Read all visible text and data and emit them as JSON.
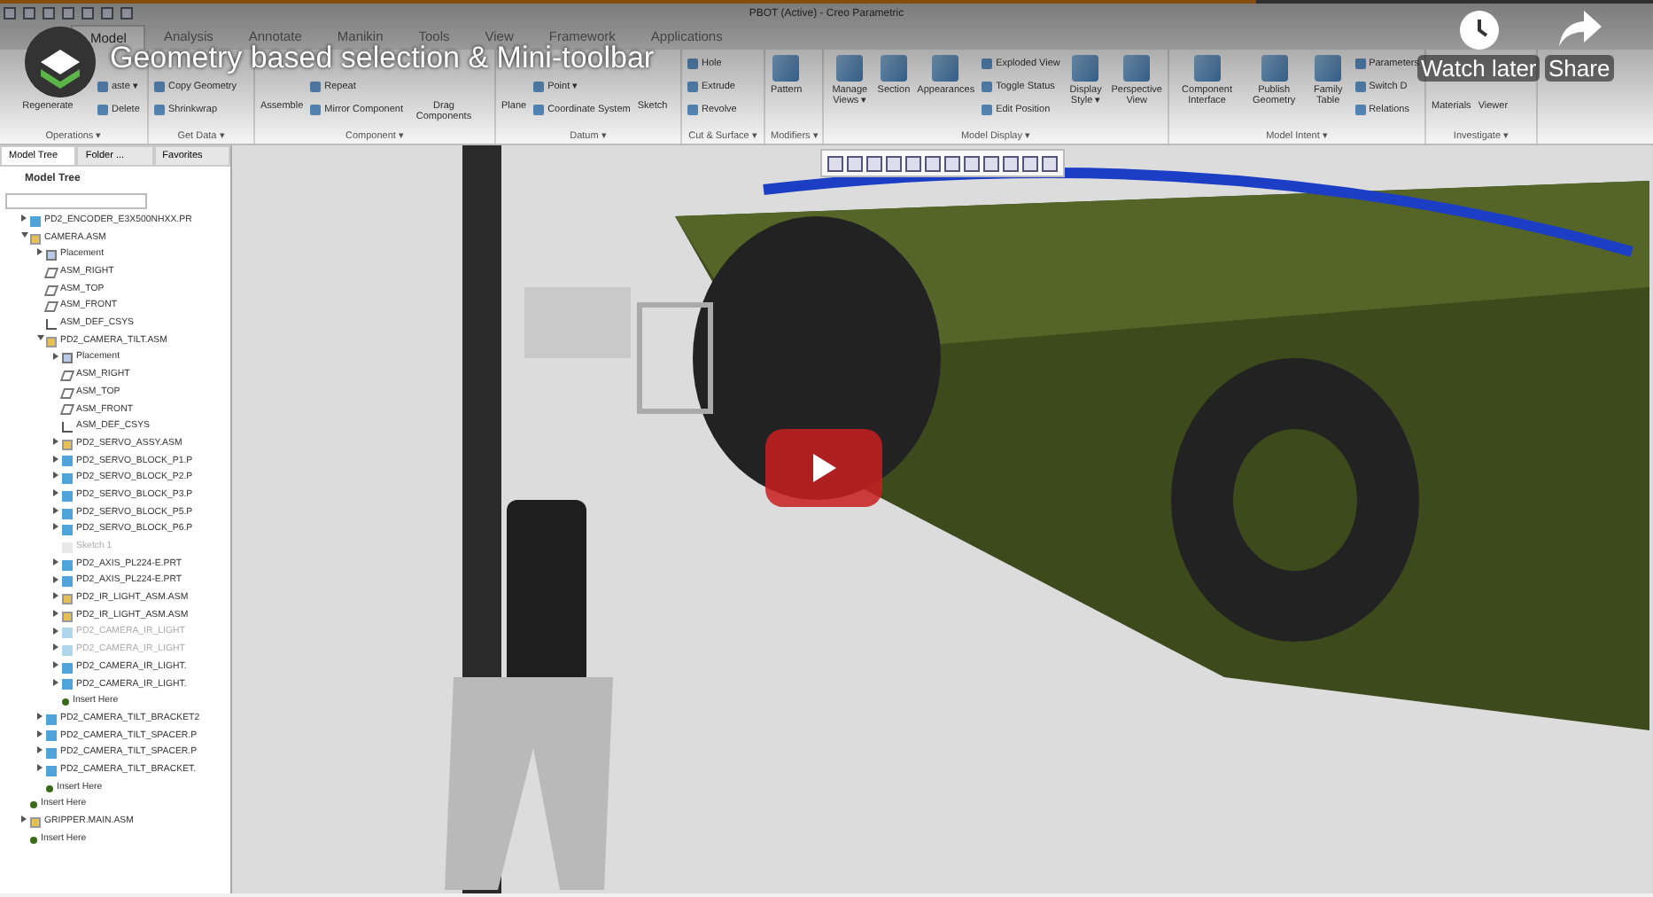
{
  "progress": {
    "level": 0.76
  },
  "window": {
    "title": "PBOT (Active) - Creo Parametric"
  },
  "ribbon_tabs": [
    {
      "label": "Model",
      "selected": true
    },
    {
      "label": "Analysis",
      "selected": false
    },
    {
      "label": "Annotate",
      "selected": false
    },
    {
      "label": "Manikin",
      "selected": false
    },
    {
      "label": "Tools",
      "selected": false
    },
    {
      "label": "View",
      "selected": false
    },
    {
      "label": "Framework",
      "selected": false
    },
    {
      "label": "Applications",
      "selected": false
    }
  ],
  "ribbon_groups": [
    {
      "label": "Operations ▾",
      "items": [
        {
          "kind": "large",
          "label": "Regenerate"
        },
        {
          "kind": "stack",
          "labels": [
            "aste ▾",
            "Delete"
          ]
        }
      ]
    },
    {
      "label": "Get Data ▾",
      "items": [
        {
          "kind": "stack",
          "labels": [
            "Copy Geometry",
            "Shrinkwrap"
          ]
        }
      ]
    },
    {
      "label": "Component ▾",
      "items": [
        {
          "kind": "large",
          "label": "Assemble"
        },
        {
          "kind": "stack",
          "labels": [
            "Repeat",
            "Mirror Component"
          ]
        },
        {
          "kind": "large",
          "label": "Drag Components"
        }
      ]
    },
    {
      "label": "Datum ▾",
      "items": [
        {
          "kind": "large",
          "label": "Plane"
        },
        {
          "kind": "stack",
          "labels": [
            "Point ▾",
            "Coordinate System"
          ]
        },
        {
          "kind": "large",
          "label": "Sketch"
        }
      ]
    },
    {
      "label": "Cut & Surface ▾",
      "items": [
        {
          "kind": "stack",
          "labels": [
            "Hole",
            "Extrude",
            "Revolve"
          ]
        }
      ]
    },
    {
      "label": "Modifiers ▾",
      "items": [
        {
          "kind": "large",
          "label": "Pattern"
        }
      ]
    },
    {
      "label": "Model Display ▾",
      "items": [
        {
          "kind": "large",
          "label": "Manage Views ▾"
        },
        {
          "kind": "large",
          "label": "Section"
        },
        {
          "kind": "large",
          "label": "Appearances"
        },
        {
          "kind": "stack",
          "labels": [
            "Exploded View",
            "Toggle Status",
            "Edit Position"
          ]
        },
        {
          "kind": "large",
          "label": "Display Style ▾"
        },
        {
          "kind": "large",
          "label": "Perspective View"
        }
      ]
    },
    {
      "label": "Model Intent ▾",
      "items": [
        {
          "kind": "large",
          "label": "Component Interface"
        },
        {
          "kind": "large",
          "label": "Publish Geometry"
        },
        {
          "kind": "large",
          "label": "Family Table"
        },
        {
          "kind": "stack",
          "labels": [
            "Parameters",
            "Switch D",
            "Relations"
          ]
        }
      ]
    },
    {
      "label": "Investigate ▾",
      "items": [
        {
          "kind": "large",
          "label": "Materials"
        },
        {
          "kind": "large",
          "label": "Viewer"
        }
      ]
    }
  ],
  "model_tree": {
    "tabs": [
      {
        "label": "Model Tree",
        "selected": true
      },
      {
        "label": "Folder ...",
        "selected": false
      },
      {
        "label": "Favorites",
        "selected": false
      }
    ],
    "title": "Model Tree",
    "items": [
      {
        "kind": "part",
        "label": "PD2_ENCODER_E3X500NHXX.PR",
        "expanded": false,
        "dimmed": false
      },
      {
        "kind": "asm",
        "label": "CAMERA.ASM",
        "expanded": true,
        "dimmed": false,
        "children": [
          {
            "kind": "placement",
            "label": "Placement",
            "expanded": false,
            "dimmed": false
          },
          {
            "kind": "datum",
            "label": "ASM_RIGHT",
            "dimmed": false
          },
          {
            "kind": "datum",
            "label": "ASM_TOP",
            "dimmed": false
          },
          {
            "kind": "datum",
            "label": "ASM_FRONT",
            "dimmed": false
          },
          {
            "kind": "csys",
            "label": "ASM_DEF_CSYS",
            "dimmed": false
          },
          {
            "kind": "asm",
            "label": "PD2_CAMERA_TILT.ASM",
            "expanded": true,
            "dimmed": false,
            "children": [
              {
                "kind": "placement",
                "label": "Placement",
                "expanded": false,
                "dimmed": false
              },
              {
                "kind": "datum",
                "label": "ASM_RIGHT",
                "dimmed": false
              },
              {
                "kind": "datum",
                "label": "ASM_TOP",
                "dimmed": false
              },
              {
                "kind": "datum",
                "label": "ASM_FRONT",
                "dimmed": false
              },
              {
                "kind": "csys",
                "label": "ASM_DEF_CSYS",
                "dimmed": false
              },
              {
                "kind": "asm",
                "label": "PD2_SERVO_ASSY.ASM",
                "expanded": false,
                "dimmed": false
              },
              {
                "kind": "part",
                "label": "PD2_SERVO_BLOCK_P1.P",
                "expanded": false,
                "dimmed": false
              },
              {
                "kind": "part",
                "label": "PD2_SERVO_BLOCK_P2.P",
                "expanded": false,
                "dimmed": false
              },
              {
                "kind": "part",
                "label": "PD2_SERVO_BLOCK_P3.P",
                "expanded": false,
                "dimmed": false
              },
              {
                "kind": "part",
                "label": "PD2_SERVO_BLOCK_P5.P",
                "expanded": false,
                "dimmed": false
              },
              {
                "kind": "part",
                "label": "PD2_SERVO_BLOCK_P6.P",
                "expanded": false,
                "dimmed": false
              },
              {
                "kind": "sketch",
                "label": "Sketch 1",
                "dimmed": true
              },
              {
                "kind": "part",
                "label": "PD2_AXIS_PL224-E.PRT",
                "expanded": false,
                "dimmed": false
              },
              {
                "kind": "part",
                "label": "PD2_AXIS_PL224-E.PRT",
                "expanded": false,
                "dimmed": false
              },
              {
                "kind": "asm",
                "label": "PD2_IR_LIGHT_ASM.ASM",
                "expanded": false,
                "dimmed": false
              },
              {
                "kind": "asm",
                "label": "PD2_IR_LIGHT_ASM.ASM",
                "expanded": false,
                "dimmed": false
              },
              {
                "kind": "part",
                "label": "PD2_CAMERA_IR_LIGHT",
                "expanded": false,
                "dimmed": true
              },
              {
                "kind": "part",
                "label": "PD2_CAMERA_IR_LIGHT",
                "expanded": false,
                "dimmed": true
              },
              {
                "kind": "part",
                "label": "PD2_CAMERA_IR_LIGHT.",
                "expanded": false,
                "dimmed": false
              },
              {
                "kind": "part",
                "label": "PD2_CAMERA_IR_LIGHT.",
                "expanded": false,
                "dimmed": false
              },
              {
                "kind": "insert",
                "label": "Insert Here",
                "dimmed": false
              }
            ]
          },
          {
            "kind": "part",
            "label": "PD2_CAMERA_TILT_BRACKET2",
            "expanded": false,
            "dimmed": false
          },
          {
            "kind": "part",
            "label": "PD2_CAMERA_TILT_SPACER.P",
            "expanded": false,
            "dimmed": false
          },
          {
            "kind": "part",
            "label": "PD2_CAMERA_TILT_SPACER.P",
            "expanded": false,
            "dimmed": false
          },
          {
            "kind": "part",
            "label": "PD2_CAMERA_TILT_BRACKET.",
            "expanded": false,
            "dimmed": false
          },
          {
            "kind": "insert",
            "label": "Insert Here",
            "dimmed": false
          }
        ]
      },
      {
        "kind": "insert",
        "label": "Insert Here",
        "dimmed": false
      },
      {
        "kind": "asm",
        "label": "GRIPPER.MAIN.ASM",
        "expanded": false,
        "dimmed": false
      },
      {
        "kind": "insert",
        "label": "Insert Here",
        "dimmed": false
      }
    ]
  },
  "video": {
    "title": "Geometry based selection & Mini-toolbar",
    "watch_later": "Watch later",
    "share": "Share"
  }
}
